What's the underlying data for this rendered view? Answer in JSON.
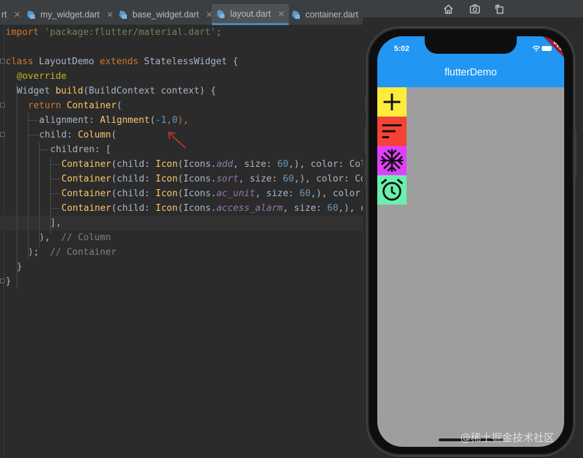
{
  "tabs": [
    {
      "label": "rt",
      "active": false
    },
    {
      "label": "my_widget.dart",
      "active": false
    },
    {
      "label": "base_widget.dart",
      "active": false
    },
    {
      "label": "layout.dart",
      "active": true
    },
    {
      "label": "container.dart",
      "active": false
    }
  ],
  "code": {
    "l1": {
      "kw": "import",
      "str": "'package:flutter/material.dart'",
      "end": ";"
    },
    "l3": {
      "kw1": "class",
      "name": "LayoutDemo",
      "kw2": "extends",
      "base": "StatelessWidget",
      "end": "{"
    },
    "l4": {
      "ann": "@override"
    },
    "l5": {
      "type": "Widget",
      "fn": "build",
      "args": "(BuildContext context) {"
    },
    "l6": {
      "kw": "return",
      "cls": "Container",
      "end": "("
    },
    "l7": {
      "prop": "alignment: ",
      "cls": "Alignment",
      "open": "(",
      "n1": "-1",
      "comma": ",",
      "n2": "0",
      "end": "),"
    },
    "l8": {
      "prop": "child: ",
      "cls": "Column",
      "end": "("
    },
    "l9": {
      "text": "children: ["
    },
    "rows": [
      {
        "container": "Container",
        "pre": "(child: ",
        "icon": "Icon",
        "icons": "(Icons.",
        "name": "add",
        "size": ", size: ",
        "num": "60",
        "post": ",), color: Col"
      },
      {
        "container": "Container",
        "pre": "(child: ",
        "icon": "Icon",
        "icons": "(Icons.",
        "name": "sort",
        "size": ", size: ",
        "num": "60",
        "post": ",), color: Co"
      },
      {
        "container": "Container",
        "pre": "(child: ",
        "icon": "Icon",
        "icons": "(Icons.",
        "name": "ac_unit",
        "size": ", size: ",
        "num": "60",
        "post": ",), color:"
      },
      {
        "container": "Container",
        "pre": "(child: ",
        "icon": "Icon",
        "icons": "(Icons.",
        "name": "access_alarm",
        "size": ", size: ",
        "num": "60",
        "post": ",), c"
      }
    ],
    "l14": {
      "text": "],"
    },
    "l15": {
      "text": "),",
      "cmt": "// Column"
    },
    "l16": {
      "text": ");",
      "cmt": "// Container"
    },
    "l17": {
      "text": "}"
    },
    "l18": {
      "text": "}"
    }
  },
  "emulator": {
    "toolbar_icons": [
      "home-icon",
      "screenshot-icon",
      "rotate-icon"
    ]
  },
  "phone": {
    "time": "5:02",
    "title": "flutterDemo",
    "ribbon": "DEBUG",
    "colors": {
      "appbar": "#2196f3",
      "body": "#9e9e9e"
    },
    "items": [
      {
        "icon": "add-icon",
        "color": "#ffeb3b"
      },
      {
        "icon": "sort-icon",
        "color": "#f44336"
      },
      {
        "icon": "ac-unit-icon",
        "color": "#e040fb"
      },
      {
        "icon": "access-alarm-icon",
        "color": "#69f0ae"
      }
    ]
  },
  "watermark": "@稀土掘金技术社区"
}
